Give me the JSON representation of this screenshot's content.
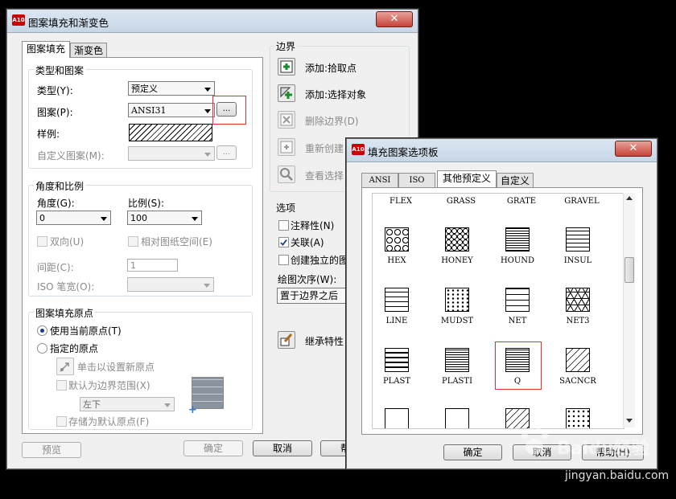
{
  "main_dialog": {
    "title": "图案填充和渐变色",
    "app_icon": "A10",
    "close_symbol": "✕",
    "tabs": [
      "图案填充",
      "渐变色"
    ],
    "type_pattern": {
      "group_label": "类型和图案",
      "type_label": "类型(Y):",
      "type_value": "预定义",
      "pattern_label": "图案(P):",
      "pattern_value": "ANSI31",
      "browse_label": "...",
      "swatch_label": "样例:",
      "custom_label": "自定义图案(M):",
      "custom_browse_label": "..."
    },
    "angle_scale": {
      "group_label": "角度和比例",
      "angle_label": "角度(G):",
      "angle_value": "0",
      "scale_label": "比例(S):",
      "scale_value": "100",
      "double_label": "双向(U)",
      "relative_label": "相对图纸空间(E)",
      "spacing_label": "间距(C):",
      "spacing_value": "1",
      "iso_label": "ISO 笔宽(O):"
    },
    "origin": {
      "group_label": "图案填充原点",
      "use_current_label": "使用当前原点(T)",
      "specified_label": "指定的原点",
      "click_set_label": "单击以设置新原点",
      "default_extents_label": "默认为边界范围(X)",
      "position_value": "左下",
      "store_default_label": "存储为默认原点(F)"
    },
    "boundary": {
      "group_label": "边界",
      "add_pick_label": "添加:拾取点",
      "add_select_label": "添加:选择对象",
      "remove_label": "删除边界(D)",
      "recreate_label": "重新创建",
      "view_label": "查看选择"
    },
    "options": {
      "group_label": "选项",
      "annotative_label": "注释性(N)",
      "associative_label": "关联(A)",
      "independent_label": "创建独立的图",
      "draw_order_label": "绘图次序(W):",
      "draw_order_value": "置于边界之后",
      "inherit_label": "继承特性"
    },
    "footer": {
      "preview_label": "预览",
      "ok_label": "确定",
      "cancel_label": "取消",
      "help_label": "帮"
    }
  },
  "palette_dialog": {
    "title": "填充图案选项板",
    "app_icon": "A10",
    "close_symbol": "✕",
    "tabs": [
      "ANSI",
      "ISO",
      "其他预定义",
      "自定义"
    ],
    "patterns": [
      {
        "name": "FLEX",
        "icon": "flex-pattern"
      },
      {
        "name": "GRASS",
        "icon": "grass-pattern"
      },
      {
        "name": "GRATE",
        "icon": "grate-pattern"
      },
      {
        "name": "GRAVEL",
        "icon": "gravel-pattern"
      },
      {
        "name": "HEX",
        "icon": "hex-pattern"
      },
      {
        "name": "HONEY",
        "icon": "honey-pattern"
      },
      {
        "name": "HOUND",
        "icon": "hound-pattern"
      },
      {
        "name": "INSUL",
        "icon": "insul-pattern"
      },
      {
        "name": "LINE",
        "icon": "line-pattern"
      },
      {
        "name": "MUDST",
        "icon": "mudst-pattern"
      },
      {
        "name": "NET",
        "icon": "net-pattern"
      },
      {
        "name": "NET3",
        "icon": "net3-pattern"
      },
      {
        "name": "PLAST",
        "icon": "plast-pattern"
      },
      {
        "name": "PLASTI",
        "icon": "plasti-pattern"
      },
      {
        "name": "Q",
        "icon": "q-pattern",
        "selected": true
      },
      {
        "name": "SACNCR",
        "icon": "sacncr-pattern"
      }
    ],
    "footer": {
      "ok_label": "确定",
      "cancel_label": "取消",
      "help_label": "帮助(H)"
    }
  },
  "watermark": {
    "text": "Baidu经验",
    "url": "jingyan.baidu.com"
  },
  "colors": {
    "highlight": "#e03030",
    "background": "#000000",
    "dialog": "#f0f0f0"
  }
}
